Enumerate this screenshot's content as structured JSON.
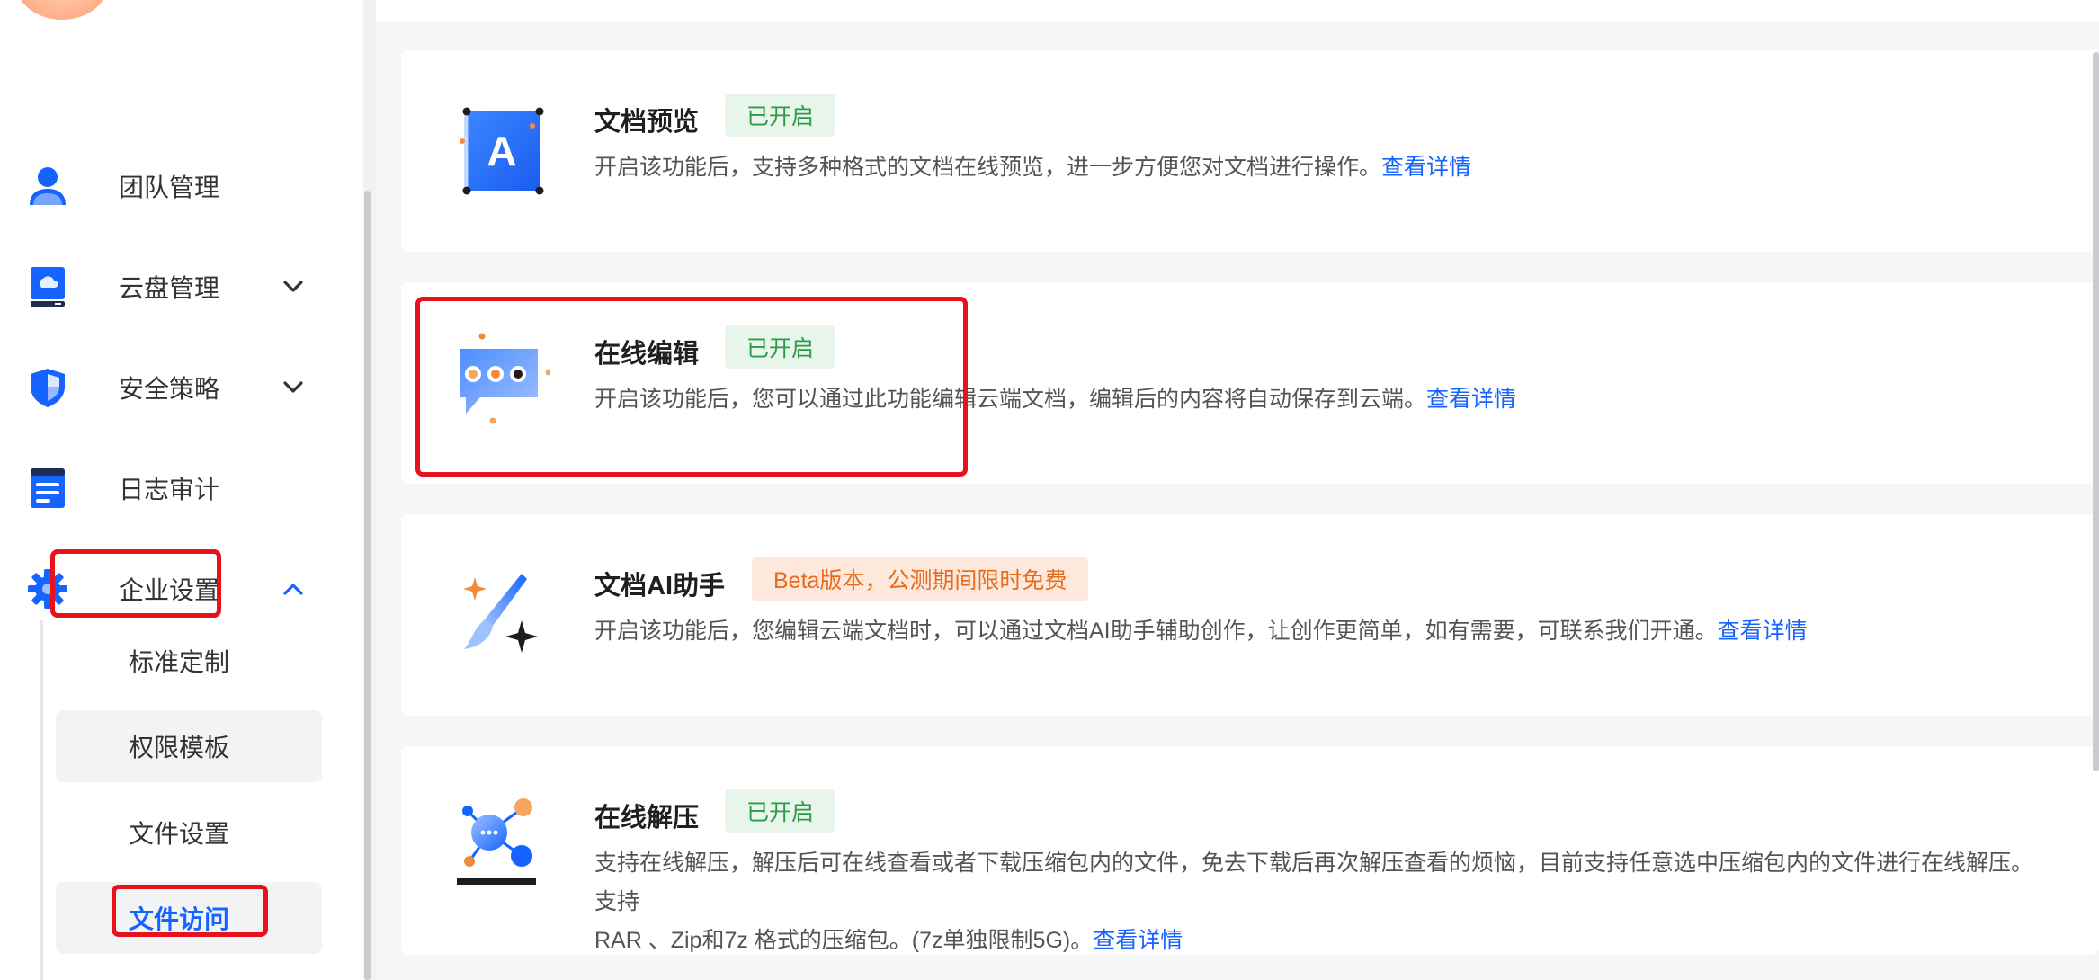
{
  "sidebar": {
    "items": [
      {
        "label": "团队管理",
        "icon": "user-icon"
      },
      {
        "label": "云盘管理",
        "icon": "cloud-drive-icon"
      },
      {
        "label": "安全策略",
        "icon": "shield-icon"
      },
      {
        "label": "日志审计",
        "icon": "log-icon"
      },
      {
        "label": "企业设置",
        "icon": "gear-icon"
      }
    ],
    "submenu": [
      {
        "label": "标准定制"
      },
      {
        "label": "权限模板"
      },
      {
        "label": "文件设置"
      },
      {
        "label": "文件访问"
      }
    ]
  },
  "cards": [
    {
      "title": "文档预览",
      "icon": "document-preview-icon",
      "badge": "已开启",
      "desc": "开启该功能后，支持多种格式的文档在线预览，进一步方便您对文档进行操作。",
      "link": "查看详情"
    },
    {
      "title": "在线编辑",
      "icon": "chat-bubble-icon",
      "badge": "已开启",
      "desc": "开启该功能后，您可以通过此功能编辑云端文档，编辑后的内容将自动保存到云端。",
      "link": "查看详情"
    },
    {
      "title": "文档AI助手",
      "icon": "ai-brush-icon",
      "badge": "Beta版本，公测期间限时免费",
      "desc": "开启该功能后，您编辑云端文档时，可以通过文档AI助手辅助创作，让创作更简单，如有需要，可联系我们开通。",
      "link": "查看详情"
    },
    {
      "title": "在线解压",
      "icon": "unzip-network-icon",
      "badge": "已开启",
      "desc_line1": "支持在线解压，解压后可在线查看或者下载压缩包内的文件，免去下载后再次解压查看的烦恼，目前支持任意选中压缩包内的文件进行在线解压。支持",
      "desc_line2": "RAR 、Zip和7z 格式的压缩包。(7z单独限制5G)。",
      "link": "查看详情"
    }
  ],
  "colors": {
    "accent": "#1664ff",
    "enabled_badge_bg": "#e8f5ea",
    "enabled_badge_text": "#2e9a48",
    "beta_badge_bg": "#fde8dc",
    "beta_badge_text": "#ea6a1c",
    "highlight": "#e6131d"
  }
}
